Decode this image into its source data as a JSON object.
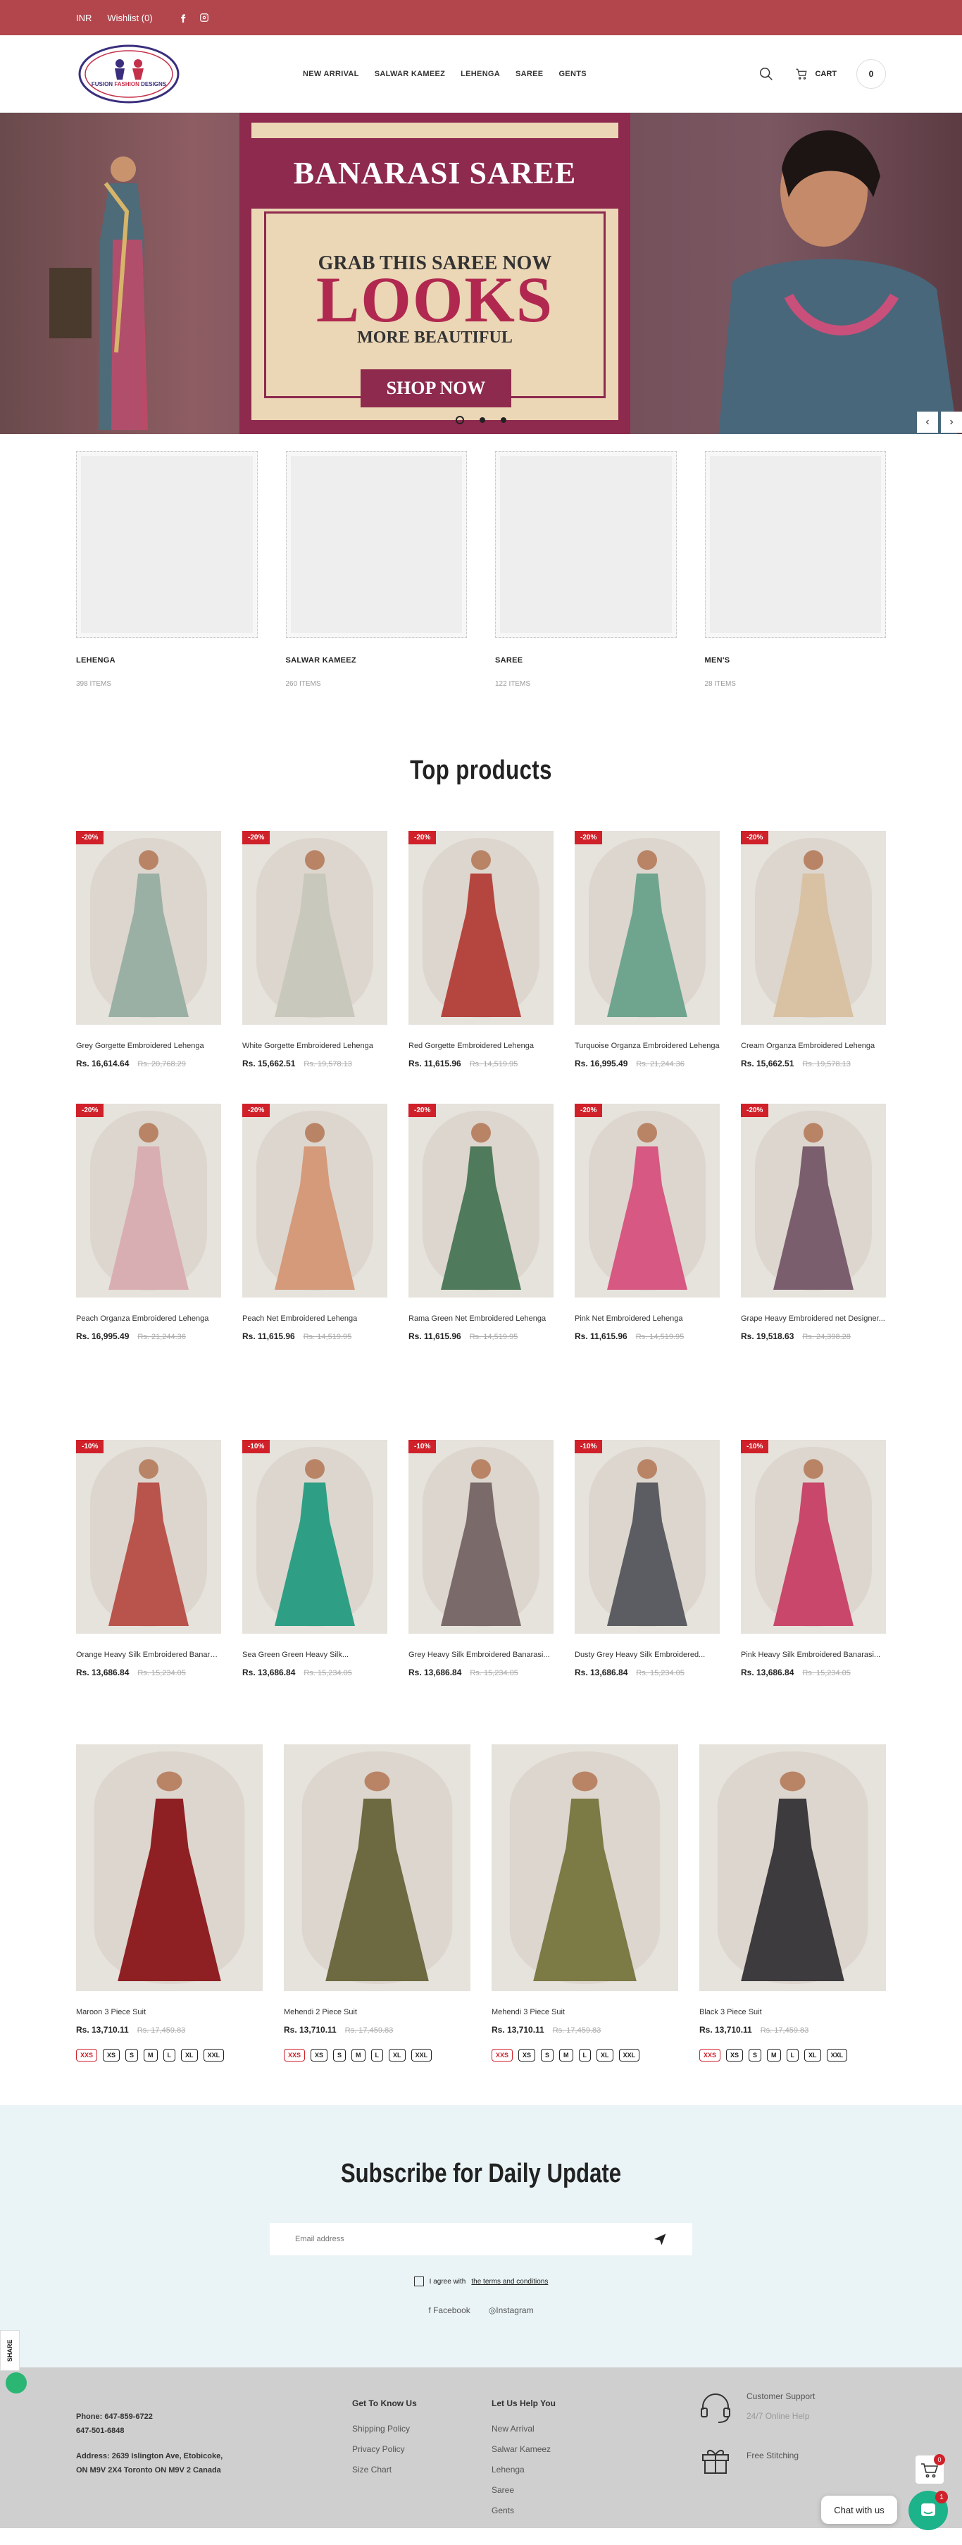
{
  "topbar": {
    "currency": "INR",
    "wishlist": "Wishlist (0)",
    "icons": [
      "facebook-icon",
      "instagram-icon"
    ]
  },
  "logo": {
    "line1": "FUSION",
    "line2": "FASHION",
    "line3": "DESIGNS"
  },
  "nav": [
    "NEW ARRIVAL",
    "SALWAR KAMEEZ",
    "LEHENGA",
    "SAREE",
    "GENTS"
  ],
  "cart": {
    "label": "CART",
    "count": "0"
  },
  "hero": {
    "title": "BANARASI SAREE",
    "grab": "GRAB THIS SAREE NOW",
    "looks": "LOOKS",
    "more": "MORE BEAUTIFUL",
    "cta": "SHOP NOW",
    "prev": "‹",
    "next": "›"
  },
  "categories": [
    {
      "name": "LEHENGA",
      "count": "398 ITEMS"
    },
    {
      "name": "SALWAR KAMEEZ",
      "count": "260 ITEMS"
    },
    {
      "name": "SAREE",
      "count": "122 ITEMS"
    },
    {
      "name": "MEN'S",
      "count": "28 ITEMS"
    }
  ],
  "top_title": "Top products",
  "row1": [
    {
      "badge": "-20%",
      "name": "Grey Gorgette Embroidered Lehenga",
      "price": "Rs. 16,614.64",
      "old": "Rs. 20,768.29",
      "color": "#9bb0a5"
    },
    {
      "badge": "-20%",
      "name": "White Gorgette Embroidered Lehenga",
      "price": "Rs. 15,662.51",
      "old": "Rs. 19,578.13",
      "color": "#c9c8bc"
    },
    {
      "badge": "-20%",
      "name": "Red Gorgette Embroidered Lehenga",
      "price": "Rs. 11,615.96",
      "old": "Rs. 14,519.95",
      "color": "#b5463f"
    },
    {
      "badge": "-20%",
      "name": "Turquoise Organza Embroidered Lehenga",
      "price": "Rs. 16,995.49",
      "old": "Rs. 21,244.36",
      "color": "#6fa58f"
    },
    {
      "badge": "-20%",
      "name": "Cream Organza Embroidered Lehenga",
      "price": "Rs. 15,662.51",
      "old": "Rs. 19,578.13",
      "color": "#d9c1a3"
    }
  ],
  "row2": [
    {
      "badge": "-20%",
      "name": "Peach Organza Embroidered Lehenga",
      "price": "Rs. 16,995.49",
      "old": "Rs. 21,244.36",
      "color": "#d9aeb2"
    },
    {
      "badge": "-20%",
      "name": "Peach Net Embroidered Lehenga",
      "price": "Rs. 11,615.96",
      "old": "Rs. 14,519.95",
      "color": "#d49a7a"
    },
    {
      "badge": "-20%",
      "name": "Rama Green Net Embroidered Lehenga",
      "price": "Rs. 11,615.96",
      "old": "Rs. 14,519.95",
      "color": "#4f7a5b"
    },
    {
      "badge": "-20%",
      "name": "Pink Net Embroidered Lehenga",
      "price": "Rs. 11,615.96",
      "old": "Rs. 14,519.95",
      "color": "#d75882"
    },
    {
      "badge": "-20%",
      "name": "Grape Heavy Embroidered net Designer...",
      "price": "Rs. 19,518.63",
      "old": "Rs. 24,398.28",
      "color": "#7a5e6e"
    }
  ],
  "row3": [
    {
      "badge": "-10%",
      "name": "Orange Heavy Silk Embroidered Banarasi...",
      "price": "Rs. 13,686.84",
      "old": "Rs. 15,234.05",
      "color": "#b9544c"
    },
    {
      "badge": "-10%",
      "name": "Sea Green Green Heavy Silk...",
      "price": "Rs. 13,686.84",
      "old": "Rs. 15,234.05",
      "color": "#2e9f85"
    },
    {
      "badge": "-10%",
      "name": "Grey Heavy Silk Embroidered Banarasi...",
      "price": "Rs. 13,686.84",
      "old": "Rs. 15,234.05",
      "color": "#7b6a6a"
    },
    {
      "badge": "-10%",
      "name": "Dusty Grey Heavy Silk Embroidered...",
      "price": "Rs. 13,686.84",
      "old": "Rs. 15,234.05",
      "color": "#5b5d62"
    },
    {
      "badge": "-10%",
      "name": "Pink Heavy Silk Embroidered Banarasi...",
      "price": "Rs. 13,686.84",
      "old": "Rs. 15,234.05",
      "color": "#c9476a"
    }
  ],
  "gents": [
    {
      "name": "Maroon 3 Piece Suit",
      "price": "Rs. 13,710.11",
      "old": "Rs. 17,459.83",
      "color": "#8e2024"
    },
    {
      "name": "Mehendi 2 Piece Suit",
      "price": "Rs. 13,710.11",
      "old": "Rs. 17,459.83",
      "color": "#6d6a42"
    },
    {
      "name": "Mehendi 3 Piece Suit",
      "price": "Rs. 13,710.11",
      "old": "Rs. 17,459.83",
      "color": "#7c7a45"
    },
    {
      "name": "Black 3 Piece Suit",
      "price": "Rs. 13,710.11",
      "old": "Rs. 17,459.83",
      "color": "#3d3b3e"
    }
  ],
  "sizes": [
    "XXS",
    "XS",
    "S",
    "M",
    "L",
    "XL",
    "XXL"
  ],
  "subscribe": {
    "title": "Subscribe for Daily Update",
    "placeholder": "Email address",
    "agree_prefix": "I agree with",
    "agree_link": "the terms and conditions",
    "facebook": "Facebook",
    "instagram": "Instagram"
  },
  "footer": {
    "phone1": "Phone: 647-859-6722",
    "phone2": "647-501-6848",
    "address1": "Address: 2639 Islington Ave, Etobicoke,",
    "address2": "ON M9V 2X4 Toronto ON M9V 2 Canada",
    "know_title": "Get To Know Us",
    "know": [
      "Shipping Policy",
      "Privacy Policy",
      "Size Chart"
    ],
    "help_title": "Let Us Help You",
    "help": [
      "New Arrival",
      "Salwar Kameez",
      "Lehenga",
      "Saree",
      "Gents"
    ],
    "support_title": "Customer Support",
    "support_sub": "24/7 Online Help",
    "gift": "Free Stitching"
  },
  "widgets": {
    "share": "SHARE",
    "chat": "Chat with us",
    "cart_badge": "0",
    "chat_badge": "1"
  },
  "colors": {
    "brand": "#b3464d",
    "badge": "#d0212a",
    "chat": "#1cb28a"
  }
}
